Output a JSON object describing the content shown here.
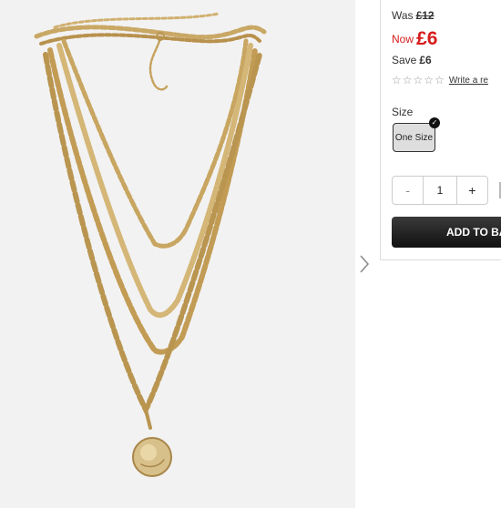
{
  "price": {
    "was_label": "Was",
    "was_value": "£12",
    "now_label": "Now",
    "now_value": "£6",
    "save_label": "Save",
    "save_value": "£6",
    "now_color": "#d61c1c"
  },
  "rating": {
    "stars_filled": 0,
    "stars_total": 5,
    "review_link": "Write a re"
  },
  "size": {
    "label": "Size",
    "selected": "One Size"
  },
  "quantity": {
    "minus": "-",
    "value": "1",
    "plus": "+"
  },
  "add_to_bag": "ADD TO BA",
  "icons": {
    "next": "chevron-right-icon",
    "star": "star-outline-icon",
    "check": "check-badge-icon"
  }
}
